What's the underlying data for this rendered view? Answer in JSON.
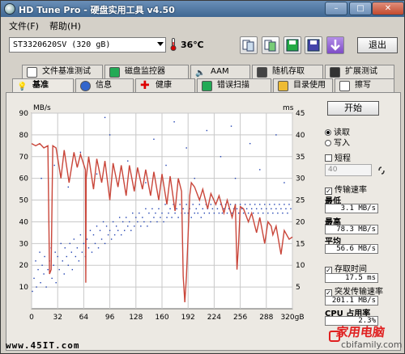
{
  "window": {
    "title": "HD Tune Pro - 硬盘实用工具 v4.50"
  },
  "titlebar_buttons": {
    "minimize": "–",
    "maximize": "□",
    "close": "✕"
  },
  "menu": [
    "文件(F)",
    "帮助(H)"
  ],
  "toolbar": {
    "drive": "ST3320620SV (320 gB)",
    "temperature": "36℃",
    "exit_label": "退出"
  },
  "tabs_row1": [
    "文件基准测试",
    "磁盘监控器",
    "AAM",
    "随机存取",
    "扩展测试"
  ],
  "tabs_row2": [
    "基准",
    "信息",
    "健康",
    "错误扫描",
    "目录使用",
    "擦写"
  ],
  "side": {
    "start": "开始",
    "read": "读取",
    "write": "写入",
    "short_stroke": "短程",
    "block_value": "40",
    "transfer_rate": "传输速率",
    "min_label": "最低",
    "min_value": "3.1 MB/s",
    "max_label": "最高",
    "max_value": "78.3 MB/s",
    "avg_label": "平均",
    "avg_value": "56.6 MB/s",
    "access_time": "存取时间",
    "access_value": "17.5 ms",
    "burst_rate": "突发传输速率",
    "burst_value": "201.1 MB/s",
    "cpu_label": "CPU 占用率",
    "cpu_value": "2.3%"
  },
  "colors": {
    "curve": "#c9463a",
    "dots": "#1d3fb0",
    "plot_bg": "#ffffff",
    "grid": "#c8c8c8"
  },
  "chart_data": {
    "type": "line",
    "y_left_label": "MB/s",
    "y_right_label": "ms",
    "y_left_ticks": [
      10,
      20,
      30,
      40,
      50,
      60,
      70,
      80,
      90
    ],
    "y_right_ticks": [
      5,
      10,
      15,
      20,
      25,
      30,
      35,
      40,
      45
    ],
    "x_ticks": [
      "0",
      "32",
      "64",
      "96",
      "128",
      "160",
      "192",
      "224",
      "256",
      "288",
      "320gB"
    ],
    "xlim": [
      0,
      320
    ],
    "ylim_left": [
      0,
      90
    ],
    "ylim_right": [
      0,
      45
    ],
    "series": [
      {
        "x": [
          0,
          5,
          10,
          15,
          20,
          22,
          24,
          26,
          30,
          36,
          40,
          46,
          52,
          56,
          60,
          66,
          66.5,
          67,
          70,
          76,
          80,
          86,
          90,
          96,
          100,
          106,
          110,
          116,
          120,
          126,
          130,
          136,
          140,
          146,
          150,
          156,
          160,
          166,
          170,
          176,
          180,
          184,
          186,
          188,
          190,
          194,
          196,
          200,
          206,
          210,
          216,
          220,
          226,
          230,
          236,
          240,
          246,
          250,
          252,
          254,
          256,
          260,
          266,
          270,
          276,
          280,
          286,
          290,
          294,
          296,
          300,
          306,
          310,
          316,
          320
        ],
        "y": [
          76,
          75,
          76,
          74,
          75,
          16,
          18,
          75,
          74,
          60,
          73,
          58,
          72,
          65,
          71,
          64,
          12,
          60,
          70,
          55,
          69,
          58,
          68,
          50,
          67,
          56,
          66,
          52,
          66,
          54,
          65,
          55,
          64,
          52,
          63,
          50,
          62,
          48,
          61,
          45,
          60,
          54,
          15,
          3,
          15,
          52,
          58,
          56,
          50,
          55,
          46,
          53,
          48,
          52,
          44,
          50,
          42,
          48,
          18,
          30,
          47,
          46,
          40,
          44,
          35,
          42,
          30,
          40,
          38,
          34,
          38,
          25,
          36,
          32,
          33
        ]
      }
    ],
    "access_time_ms": [
      [
        1,
        4
      ],
      [
        3,
        7
      ],
      [
        5,
        11
      ],
      [
        6,
        5
      ],
      [
        8,
        9
      ],
      [
        10,
        13
      ],
      [
        11,
        6
      ],
      [
        13,
        10
      ],
      [
        15,
        8
      ],
      [
        16,
        12
      ],
      [
        18,
        5
      ],
      [
        20,
        9
      ],
      [
        22,
        11
      ],
      [
        24,
        14
      ],
      [
        25,
        7
      ],
      [
        27,
        10
      ],
      [
        29,
        13
      ],
      [
        30,
        6
      ],
      [
        32,
        12
      ],
      [
        34,
        9
      ],
      [
        36,
        15
      ],
      [
        38,
        11
      ],
      [
        40,
        8
      ],
      [
        41,
        14
      ],
      [
        43,
        12
      ],
      [
        45,
        10
      ],
      [
        47,
        15
      ],
      [
        49,
        13
      ],
      [
        50,
        9
      ],
      [
        52,
        16
      ],
      [
        54,
        12
      ],
      [
        56,
        14
      ],
      [
        58,
        11
      ],
      [
        60,
        17
      ],
      [
        62,
        13
      ],
      [
        64,
        15
      ],
      [
        66,
        12
      ],
      [
        68,
        16
      ],
      [
        70,
        14
      ],
      [
        72,
        18
      ],
      [
        74,
        13
      ],
      [
        76,
        17
      ],
      [
        78,
        15
      ],
      [
        80,
        19
      ],
      [
        82,
        14
      ],
      [
        84,
        18
      ],
      [
        86,
        16
      ],
      [
        88,
        20
      ],
      [
        90,
        15
      ],
      [
        92,
        19
      ],
      [
        94,
        17
      ],
      [
        96,
        18
      ],
      [
        98,
        16
      ],
      [
        100,
        20
      ],
      [
        102,
        17
      ],
      [
        104,
        19
      ],
      [
        106,
        18
      ],
      [
        108,
        21
      ],
      [
        110,
        17
      ],
      [
        112,
        20
      ],
      [
        114,
        18
      ],
      [
        116,
        21
      ],
      [
        118,
        19
      ],
      [
        120,
        20
      ],
      [
        122,
        18
      ],
      [
        124,
        22
      ],
      [
        126,
        19
      ],
      [
        128,
        21
      ],
      [
        130,
        20
      ],
      [
        132,
        22
      ],
      [
        134,
        19
      ],
      [
        136,
        21
      ],
      [
        138,
        20
      ],
      [
        140,
        23
      ],
      [
        142,
        19
      ],
      [
        144,
        22
      ],
      [
        146,
        20
      ],
      [
        148,
        23
      ],
      [
        150,
        21
      ],
      [
        152,
        22
      ],
      [
        154,
        20
      ],
      [
        156,
        23
      ],
      [
        158,
        21
      ],
      [
        160,
        22
      ],
      [
        162,
        20
      ],
      [
        164,
        24
      ],
      [
        166,
        21
      ],
      [
        168,
        22
      ],
      [
        170,
        23
      ],
      [
        172,
        21
      ],
      [
        174,
        24
      ],
      [
        176,
        22
      ],
      [
        178,
        23
      ],
      [
        180,
        21
      ],
      [
        182,
        24
      ],
      [
        184,
        22
      ],
      [
        186,
        23
      ],
      [
        188,
        22
      ],
      [
        190,
        24
      ],
      [
        192,
        22
      ],
      [
        194,
        23
      ],
      [
        196,
        21
      ],
      [
        198,
        24
      ],
      [
        200,
        22
      ],
      [
        202,
        23
      ],
      [
        204,
        22
      ],
      [
        206,
        24
      ],
      [
        208,
        21
      ],
      [
        210,
        23
      ],
      [
        212,
        22
      ],
      [
        214,
        24
      ],
      [
        216,
        23
      ],
      [
        218,
        22
      ],
      [
        220,
        24
      ],
      [
        222,
        23
      ],
      [
        224,
        22
      ],
      [
        226,
        24
      ],
      [
        228,
        23
      ],
      [
        230,
        22
      ],
      [
        232,
        24
      ],
      [
        234,
        22
      ],
      [
        236,
        23
      ],
      [
        238,
        24
      ],
      [
        240,
        22
      ],
      [
        242,
        23
      ],
      [
        244,
        24
      ],
      [
        246,
        22
      ],
      [
        248,
        23
      ],
      [
        250,
        24
      ],
      [
        252,
        23
      ],
      [
        254,
        22
      ],
      [
        256,
        24
      ],
      [
        258,
        23
      ],
      [
        260,
        22
      ],
      [
        262,
        24
      ],
      [
        264,
        23
      ],
      [
        266,
        22
      ],
      [
        268,
        24
      ],
      [
        270,
        23
      ],
      [
        272,
        22
      ],
      [
        274,
        24
      ],
      [
        276,
        23
      ],
      [
        278,
        22
      ],
      [
        280,
        24
      ],
      [
        282,
        23
      ],
      [
        284,
        22
      ],
      [
        286,
        24
      ],
      [
        288,
        23
      ],
      [
        290,
        22
      ],
      [
        292,
        24
      ],
      [
        294,
        23
      ],
      [
        296,
        22
      ],
      [
        298,
        24
      ],
      [
        300,
        23
      ],
      [
        302,
        22
      ],
      [
        304,
        24
      ],
      [
        306,
        23
      ],
      [
        308,
        22
      ],
      [
        310,
        24
      ],
      [
        312,
        23
      ],
      [
        314,
        22
      ],
      [
        316,
        24
      ],
      [
        318,
        23
      ],
      [
        12,
        30
      ],
      [
        28,
        33
      ],
      [
        45,
        28
      ],
      [
        60,
        36
      ],
      [
        80,
        31
      ],
      [
        96,
        40
      ],
      [
        118,
        34
      ],
      [
        140,
        29
      ],
      [
        150,
        39
      ],
      [
        165,
        33
      ],
      [
        190,
        37
      ],
      [
        200,
        30
      ],
      [
        215,
        41
      ],
      [
        232,
        35
      ],
      [
        250,
        30
      ],
      [
        268,
        38
      ],
      [
        280,
        32
      ],
      [
        300,
        40
      ],
      [
        310,
        29
      ],
      [
        90,
        44
      ],
      [
        175,
        43
      ],
      [
        245,
        42
      ]
    ]
  },
  "footer": {
    "url": "www.45IT.com",
    "watermark": "家用电脑",
    "watermark_url": "cbifamily.com"
  }
}
